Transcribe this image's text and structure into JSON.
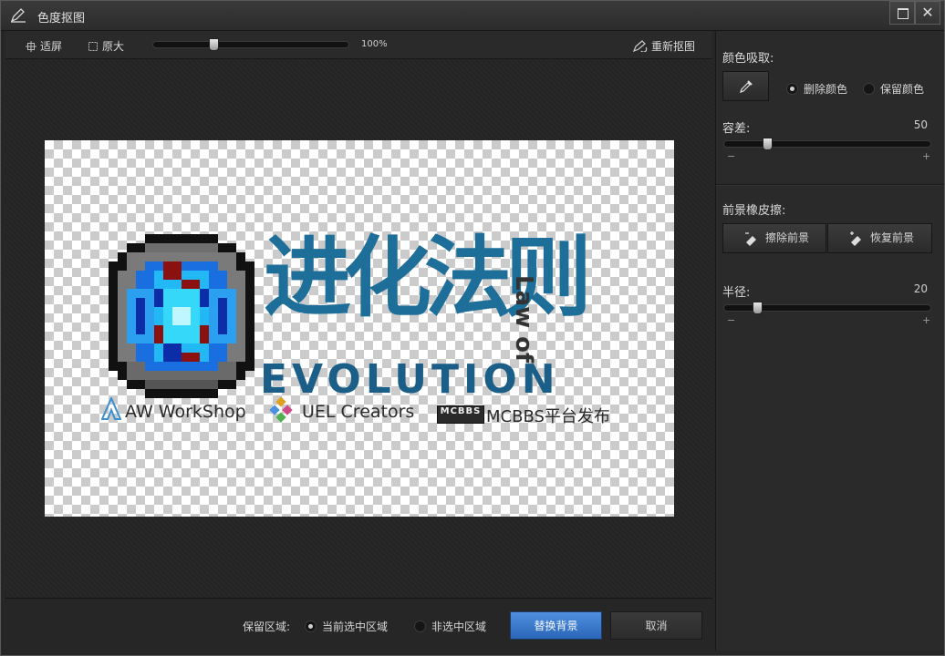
{
  "window": {
    "title": "色度抠图"
  },
  "toolbar": {
    "fit_label": "适屏",
    "original_label": "原大",
    "zoom_value": "100%",
    "zoom_level": 0.3,
    "reset_label": "重新抠图"
  },
  "artwork": {
    "title_cn": "进化法则",
    "law_of": "Law of",
    "evolution": "EVOLUTION",
    "credits": [
      {
        "name": "AW WorkShop",
        "icon": "aw-logo-icon"
      },
      {
        "name": "UEL Creators",
        "icon": "uel-logo-icon"
      },
      {
        "name": "MCBBS平台发布",
        "icon": "mcbbs-logo-icon"
      }
    ],
    "mcbbs_badge": "MCBBS"
  },
  "footer": {
    "keep_region_label": "保留区域:",
    "option_selected": "当前选中区域",
    "option_unselected": "非选中区域",
    "replace_bg_label": "替换背景",
    "cancel_label": "取消"
  },
  "panel": {
    "color_pick_label": "颜色吸取:",
    "delete_color_label": "删除颜色",
    "keep_color_label": "保留颜色",
    "tolerance_label": "容差:",
    "tolerance_value": "50",
    "eraser_label": "前景橡皮擦:",
    "erase_fg_label": "擦除前景",
    "restore_fg_label": "恢复前景",
    "radius_label": "半径:",
    "radius_value": "20",
    "minus": "−",
    "plus": "+"
  },
  "colors": {
    "accent": "#3a7bd5",
    "logo_blue": "#1d6f99",
    "panel_bg": "#2a2a2a"
  }
}
